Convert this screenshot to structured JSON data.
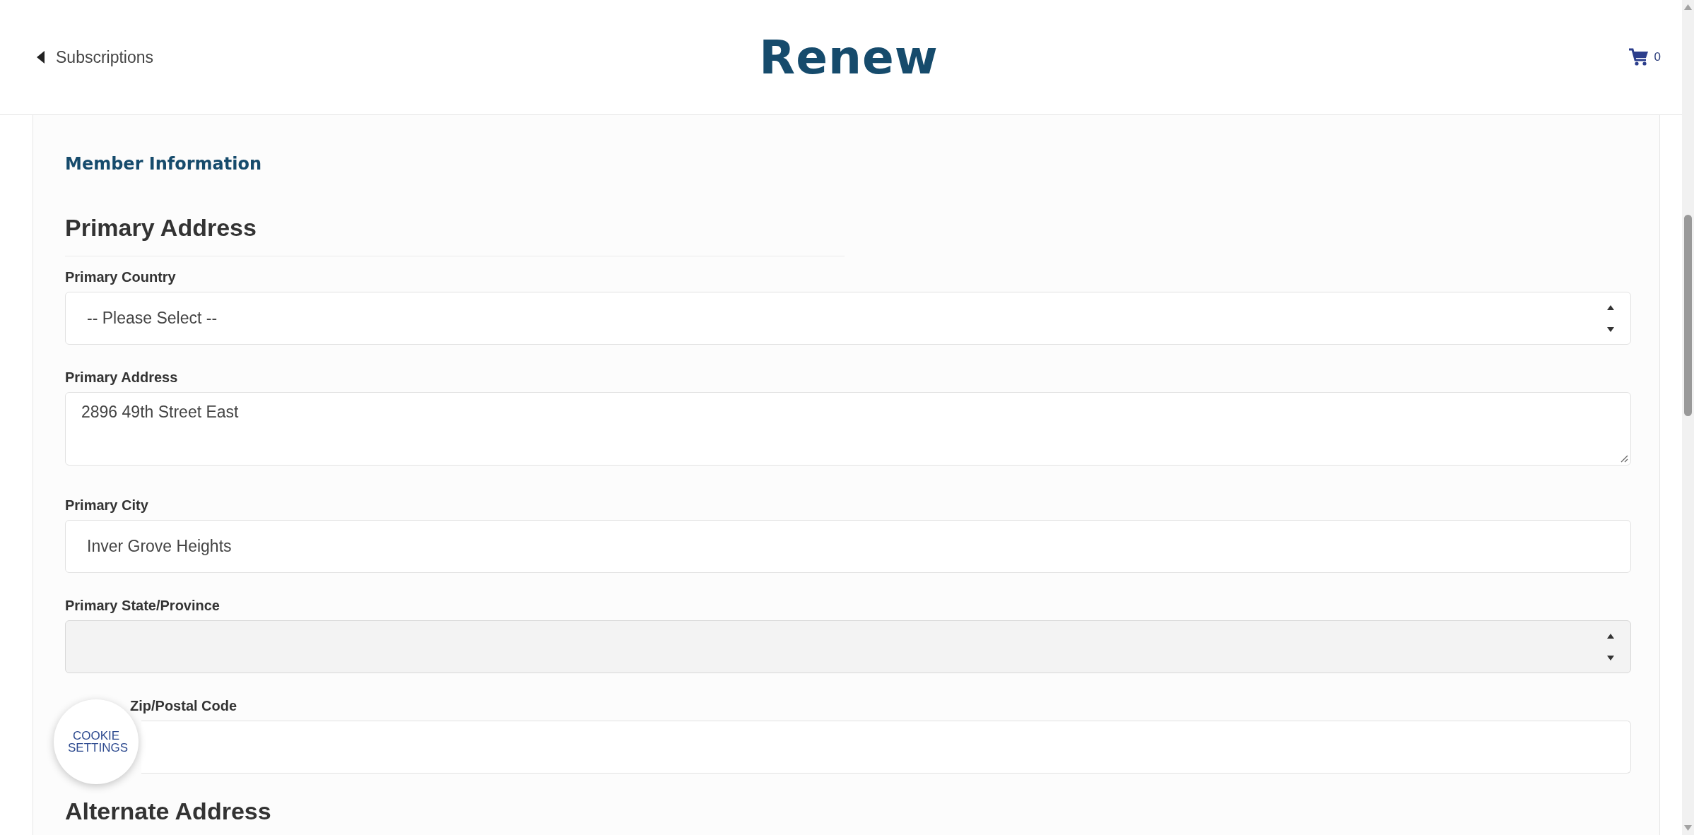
{
  "header": {
    "back_link": "Subscriptions",
    "title": "Renew",
    "cart_count": "0"
  },
  "section_title": "Member Information",
  "groups": [
    {
      "heading": "Primary Address",
      "fields": [
        {
          "kind": "select",
          "label": "Primary Country",
          "value": "-- Please Select --",
          "disabled": false
        },
        {
          "kind": "textarea",
          "label": "Primary Address",
          "value": "2896 49th Street East"
        },
        {
          "kind": "text",
          "label": "Primary City",
          "value": "Inver Grove Heights"
        },
        {
          "kind": "select",
          "label": "Primary State/Province",
          "disabled": true
        },
        {
          "kind": "text",
          "label": "Zip/Postal Code",
          "obscured": true
        }
      ]
    },
    {
      "heading": "Alternate Address"
    }
  ],
  "cookie_button": "COOKIE SETTINGS"
}
